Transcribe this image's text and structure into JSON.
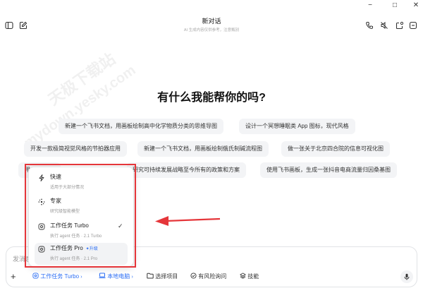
{
  "window": {
    "minimize": "−",
    "maximize": "□",
    "close": "✕"
  },
  "header": {
    "title": "新对话",
    "subtitle": "AI 生成内容仅供参考，注意甄别"
  },
  "main": {
    "heading": "有什么我能帮你的吗?",
    "suggestions": [
      "新建一个飞书文档，用画板绘制高中化学物质分类的思维导图",
      "设计一个冥想睡眠类 App 图标，现代风格",
      "开发一款极简视觉风格的节拍器应用",
      "新建一个飞书文档，用画板绘制俄氏制碱流程图",
      "做一张关于北京四合院的信息可视化图",
      "研究可持续发展战略至今所有的政策和方案",
      "使用飞书画板，生成一张抖音电商流量归因桑基图"
    ],
    "partial_suggestion": "用"
  },
  "mode_menu": {
    "options": [
      {
        "title": "快速",
        "desc": "适用于大部分情况",
        "icon": "lightning-icon"
      },
      {
        "title": "专家",
        "desc": "研究级智能模型",
        "icon": "atom-icon"
      },
      {
        "title": "工作任务 Turbo",
        "desc": "执行 agent 任务 · 2.1 Turbo",
        "icon": "task-icon",
        "selected": true
      },
      {
        "title": "工作任务 Pro",
        "desc": "执行 agent 任务 · 2.1 Pro",
        "icon": "task-icon",
        "badge": "升级"
      }
    ],
    "checkmark": "✓"
  },
  "input": {
    "placeholder": "发消息",
    "add": "+",
    "mode_label": "工作任务 Turbo",
    "local_label": "本地电脑",
    "project_label": "选择项目",
    "risk_label": "有风险询问",
    "skill_label": "技能"
  },
  "watermark": {
    "line1": "天极下载站",
    "line2": "mydown.yesky.com"
  },
  "colors": {
    "accent": "#2a6df4",
    "highlight": "#e5363a",
    "arrow": "#e5363a",
    "chip_bg": "#f3f4f6"
  }
}
